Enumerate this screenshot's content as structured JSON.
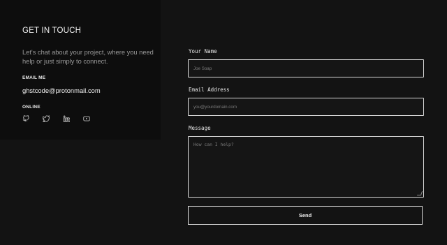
{
  "title": "GET IN TOUCH",
  "intro": "Let's chat about your project, where you need help or just simply to connect.",
  "email_me_label": "EMAIL ME",
  "email": "ghstcode@protonmail.com",
  "online_label": "ONLINE",
  "socials": [
    {
      "name": "github-icon"
    },
    {
      "name": "twitter-icon"
    },
    {
      "name": "linkedin-icon"
    },
    {
      "name": "youtube-icon"
    }
  ],
  "form": {
    "name_label": "Your Name",
    "name_placeholder": "Joe Soap",
    "email_label": "Email Address",
    "email_placeholder": "you@yourdomain.com",
    "message_label": "Message",
    "message_placeholder": "How can I help?",
    "send_label": "Send"
  },
  "colors": {
    "background": "#131313",
    "panel": "#0d0d0d",
    "border": "#d8d8d8"
  }
}
